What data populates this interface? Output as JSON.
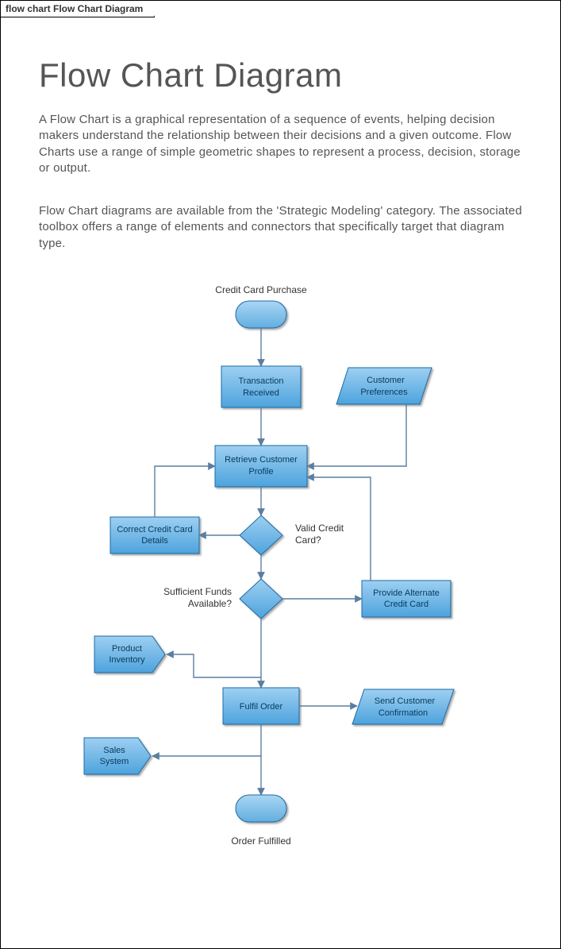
{
  "tab_label": "flow chart Flow Chart Diagram",
  "title": "Flow Chart Diagram",
  "paragraph1": "A Flow Chart is a graphical representation of a sequence of events, helping decision makers understand the relationship between their decisions and a given outcome.  Flow Charts use a range of simple geometric shapes to represent a process, decision, storage or output.",
  "paragraph2": "Flow Chart diagrams are available from the 'Strategic Modeling' category.  The associated toolbox offers a range of elements and connectors that specifically target that diagram type.",
  "diagram": {
    "start_label": "Credit Card Purchase",
    "n_transaction_l1": "Transaction",
    "n_transaction_l2": "Received",
    "n_custpref_l1": "Customer",
    "n_custpref_l2": "Preferences",
    "n_retrieve_l1": "Retrieve Customer",
    "n_retrieve_l2": "Profile",
    "n_correct_l1": "Correct Credit Card",
    "n_correct_l2": "Details",
    "d_validcard_l1": "Valid Credit",
    "d_validcard_l2": "Card?",
    "d_funds_l1": "Sufficient Funds",
    "d_funds_l2": "Available?",
    "n_altcard_l1": "Provide Alternate",
    "n_altcard_l2": "Credit Card",
    "n_inventory_l1": "Product",
    "n_inventory_l2": "Inventory",
    "n_fulfil": "Fulfil Order",
    "n_sendconf_l1": "Send Customer",
    "n_sendconf_l2": "Confirmation",
    "n_sales_l1": "Sales",
    "n_sales_l2": "System",
    "end_label": "Order Fulfilled"
  }
}
